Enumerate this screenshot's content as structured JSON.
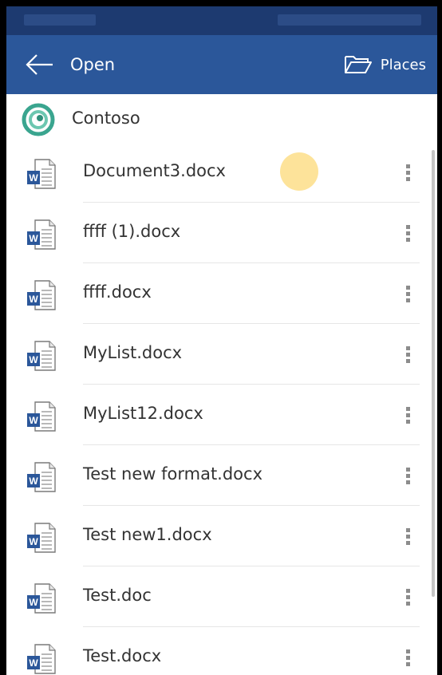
{
  "app_bar": {
    "title": "Open",
    "places_label": "Places",
    "color": "#2b579a"
  },
  "location": {
    "name": "Contoso"
  },
  "files": [
    {
      "name": "Document3.docx",
      "icon": "word-doc-icon"
    },
    {
      "name": "ffff (1).docx",
      "icon": "word-doc-icon"
    },
    {
      "name": "ffff.docx",
      "icon": "word-doc-icon"
    },
    {
      "name": "MyList.docx",
      "icon": "word-doc-icon"
    },
    {
      "name": "MyList12.docx",
      "icon": "word-doc-icon"
    },
    {
      "name": "Test new format.docx",
      "icon": "word-doc-icon"
    },
    {
      "name": "Test new1.docx",
      "icon": "word-doc-icon"
    },
    {
      "name": "Test.doc",
      "icon": "word-doc-icon"
    },
    {
      "name": "Test.docx",
      "icon": "word-doc-icon"
    }
  ],
  "colors": {
    "status_bar": "#1d3a70",
    "touch_indicator": "#fde39a",
    "contoso_logo": "#3aa58f"
  }
}
